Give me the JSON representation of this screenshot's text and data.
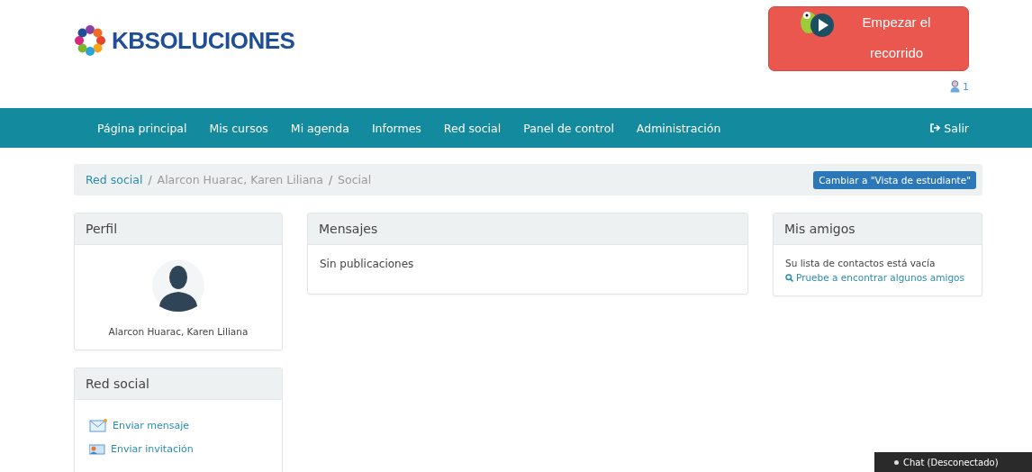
{
  "header": {
    "logo": "KBSOLUCIONES",
    "tour_button": "Empezar el recorrido",
    "notifications": "1"
  },
  "nav": {
    "items": [
      {
        "label": "Página principal"
      },
      {
        "label": "Mis cursos"
      },
      {
        "label": "Mi agenda"
      },
      {
        "label": "Informes"
      },
      {
        "label": "Red social"
      },
      {
        "label": "Panel de control"
      },
      {
        "label": "Administración"
      }
    ],
    "logout": "Salir"
  },
  "breadcrumb": {
    "items": [
      {
        "label": "Red social",
        "link": true
      },
      {
        "label": "Alarcon Huarac, Karen Liliana",
        "link": false
      },
      {
        "label": "Social",
        "link": false
      }
    ],
    "separator": "/",
    "button": "Cambiar a \"Vista de estudiante\""
  },
  "profile": {
    "title": "Perfil",
    "name": "Alarcon Huarac, Karen Liliana"
  },
  "social": {
    "title": "Red social",
    "links": [
      {
        "kind": "message",
        "label": "Enviar mensaje"
      },
      {
        "kind": "invite",
        "label": "Enviar invitación"
      }
    ]
  },
  "messages": {
    "title": "Mensajes",
    "empty": "Sin publicaciones"
  },
  "friends": {
    "title": "Mis amigos",
    "empty": "Su lista de contactos está vacía",
    "find_link": "Pruebe a encontrar algunos amigos"
  },
  "chat": {
    "label": "Chat (Desconectado)"
  }
}
